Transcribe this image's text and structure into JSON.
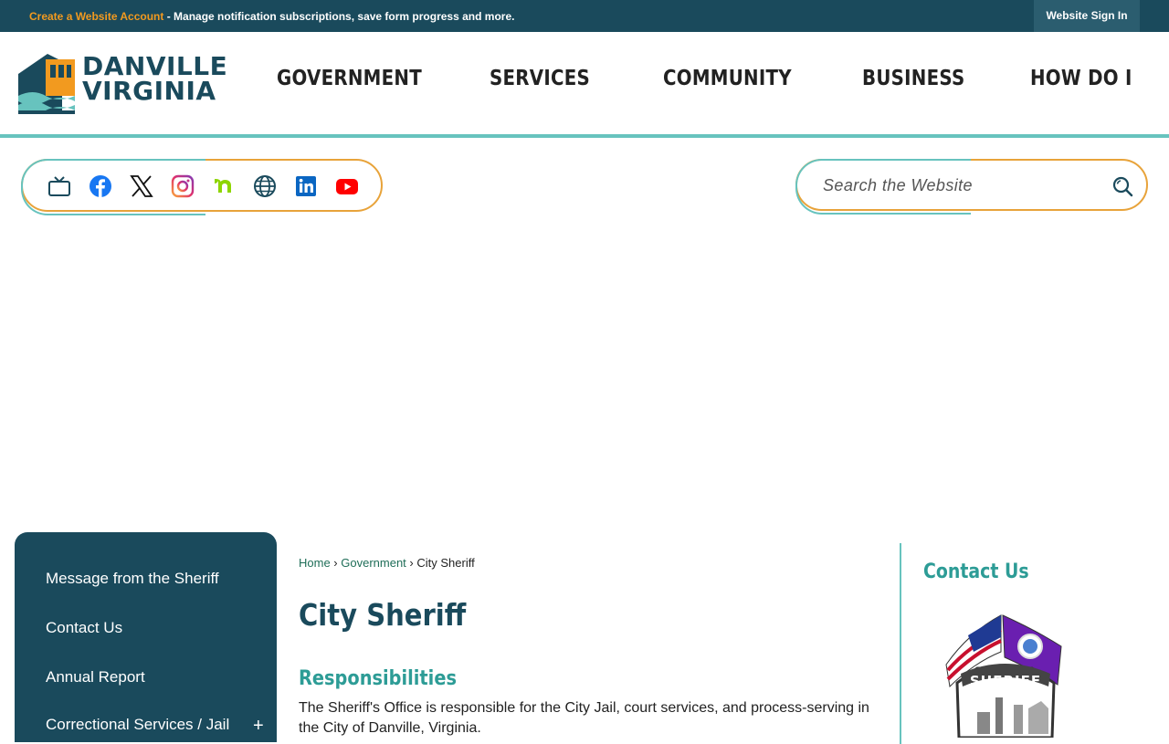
{
  "topbar": {
    "account_link": "Create a Website Account",
    "message": " - Manage notification subscriptions, save form progress and more.",
    "signin": "Website Sign In"
  },
  "logo": {
    "line1": "DANVILLE",
    "line2": "VIRGINIA"
  },
  "nav": [
    "GOVERNMENT",
    "SERVICES",
    "COMMUNITY",
    "BUSINESS",
    "HOW DO I"
  ],
  "social_icons": [
    "tv-icon",
    "facebook-icon",
    "x-icon",
    "instagram-icon",
    "nextdoor-icon",
    "globe-icon",
    "linkedin-icon",
    "youtube-icon"
  ],
  "search": {
    "placeholder": "Search the Website"
  },
  "sidebar": {
    "items": [
      "Message from the Sheriff",
      "Contact Us",
      "Annual Report",
      "Correctional Services / Jail"
    ],
    "expand": "+"
  },
  "breadcrumb": {
    "home": "Home",
    "sep1": " › ",
    "government": "Government",
    "sep2": " › ",
    "current": "City Sheriff"
  },
  "page": {
    "title": "City Sheriff",
    "section_title": "Responsibilities",
    "paragraph": "The Sheriff's Office is responsible for the City Jail, court services, and process-serving in the City of Danville, Virginia."
  },
  "contact": {
    "title": "Contact Us",
    "badge_text": "SHERIFF"
  },
  "colors": {
    "primary": "#1a4a5c",
    "accent_teal": "#67c3be",
    "accent_orange": "#f29a1f",
    "heading_teal": "#2d9c96"
  }
}
